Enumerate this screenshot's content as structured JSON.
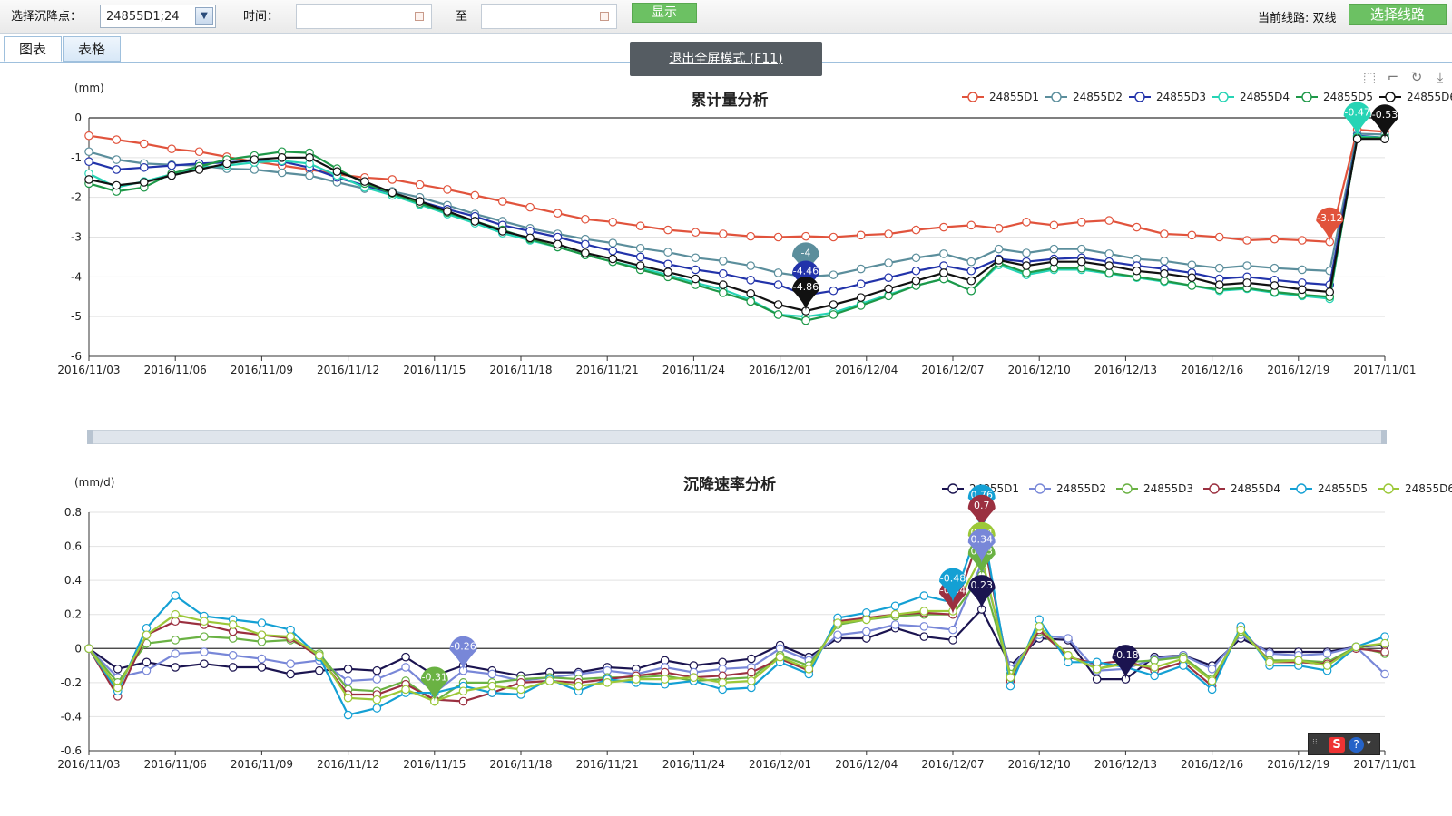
{
  "toolbar": {
    "point_label": "选择沉降点：",
    "point_value": "24855D1;24",
    "time_label": "时间：",
    "to_label": "至",
    "time_start": "",
    "time_end": "",
    "show_button": "显示",
    "line_label": "当前线路: 双线",
    "select_line_button": "选择线路"
  },
  "tabs": [
    {
      "label": "图表",
      "active": true
    },
    {
      "label": "表格",
      "active": false
    }
  ],
  "fullscreen_banner": "退出全屏模式 (F11)",
  "tool_icons": [
    "zoom-select-icon",
    "zoom-reset-icon",
    "restore-icon",
    "download-icon"
  ],
  "chart_data": [
    {
      "type": "line",
      "title": "累计量分析",
      "ylabel": "(mm)",
      "ylim": [
        -6,
        0
      ],
      "yticks": [
        "0",
        "-1",
        "-2",
        "-3",
        "-4",
        "-5",
        "-6"
      ],
      "xticks": [
        "2016/11/03",
        "2016/11/06",
        "2016/11/09",
        "2016/11/12",
        "2016/11/15",
        "2016/11/18",
        "2016/11/21",
        "2016/11/24",
        "2016/12/01",
        "2016/12/04",
        "2016/12/07",
        "2016/12/10",
        "2016/12/13",
        "2016/12/16",
        "2016/12/19",
        "2017/11/01"
      ],
      "legend_position": "top-right",
      "series": [
        {
          "name": "24855D1",
          "color": "#e1533c",
          "values": [
            -0.45,
            -0.55,
            -0.65,
            -0.78,
            -0.85,
            -0.98,
            -1.1,
            -1.2,
            -1.3,
            -1.42,
            -1.5,
            -1.55,
            -1.68,
            -1.8,
            -1.95,
            -2.1,
            -2.25,
            -2.4,
            -2.55,
            -2.62,
            -2.72,
            -2.82,
            -2.88,
            -2.92,
            -2.98,
            -3.0,
            -2.98,
            -3.0,
            -2.95,
            -2.92,
            -2.82,
            -2.75,
            -2.7,
            -2.78,
            -2.62,
            -2.7,
            -2.62,
            -2.58,
            -2.75,
            -2.92,
            -2.95,
            -3.0,
            -3.08,
            -3.05,
            -3.08,
            -3.12,
            -0.3,
            -0.35
          ]
        },
        {
          "name": "24855D2",
          "color": "#5b8e9c",
          "values": [
            -0.85,
            -1.05,
            -1.15,
            -1.18,
            -1.2,
            -1.28,
            -1.3,
            -1.38,
            -1.45,
            -1.62,
            -1.78,
            -1.85,
            -2.0,
            -2.2,
            -2.42,
            -2.6,
            -2.78,
            -2.92,
            -3.05,
            -3.15,
            -3.28,
            -3.38,
            -3.52,
            -3.6,
            -3.72,
            -3.9,
            -4.0,
            -3.95,
            -3.8,
            -3.65,
            -3.52,
            -3.42,
            -3.62,
            -3.3,
            -3.4,
            -3.3,
            -3.3,
            -3.42,
            -3.55,
            -3.6,
            -3.7,
            -3.78,
            -3.72,
            -3.78,
            -3.82,
            -3.85,
            -0.4,
            -0.42
          ]
        },
        {
          "name": "24855D3",
          "color": "#2233aa",
          "values": [
            -1.1,
            -1.3,
            -1.25,
            -1.2,
            -1.15,
            -1.12,
            -1.08,
            -1.1,
            -1.25,
            -1.5,
            -1.7,
            -1.9,
            -2.1,
            -2.3,
            -2.48,
            -2.7,
            -2.85,
            -3.0,
            -3.18,
            -3.35,
            -3.5,
            -3.68,
            -3.82,
            -3.92,
            -4.08,
            -4.2,
            -4.46,
            -4.35,
            -4.18,
            -4.02,
            -3.85,
            -3.72,
            -3.85,
            -3.55,
            -3.62,
            -3.55,
            -3.52,
            -3.62,
            -3.72,
            -3.8,
            -3.9,
            -4.05,
            -4.0,
            -4.08,
            -4.15,
            -4.2,
            -0.45,
            -0.5
          ]
        },
        {
          "name": "24855D4",
          "color": "#26d4b5",
          "values": [
            -1.4,
            -1.75,
            -1.6,
            -1.42,
            -1.25,
            -1.2,
            -1.12,
            -1.08,
            -1.15,
            -1.45,
            -1.75,
            -1.95,
            -2.18,
            -2.42,
            -2.65,
            -2.9,
            -3.08,
            -3.25,
            -3.45,
            -3.62,
            -3.78,
            -3.95,
            -4.15,
            -4.32,
            -4.58,
            -4.95,
            -5.0,
            -4.9,
            -4.68,
            -4.45,
            -4.22,
            -4.05,
            -4.35,
            -3.7,
            -3.95,
            -3.82,
            -3.82,
            -3.92,
            -4.02,
            -4.12,
            -4.22,
            -4.35,
            -4.3,
            -4.4,
            -4.48,
            -4.55,
            -0.47,
            -0.5
          ]
        },
        {
          "name": "24855D5",
          "color": "#1e9848",
          "values": [
            -1.65,
            -1.85,
            -1.75,
            -1.4,
            -1.22,
            -1.05,
            -0.95,
            -0.85,
            -0.88,
            -1.28,
            -1.65,
            -1.9,
            -2.15,
            -2.38,
            -2.6,
            -2.82,
            -3.05,
            -3.25,
            -3.45,
            -3.62,
            -3.82,
            -4.0,
            -4.2,
            -4.4,
            -4.62,
            -4.95,
            -5.1,
            -4.95,
            -4.72,
            -4.48,
            -4.22,
            -4.05,
            -4.35,
            -3.65,
            -3.9,
            -3.78,
            -3.78,
            -3.9,
            -4.0,
            -4.1,
            -4.22,
            -4.32,
            -4.28,
            -4.38,
            -4.45,
            -4.5,
            -0.5,
            -0.5
          ]
        },
        {
          "name": "24855D6",
          "color": "#111111",
          "values": [
            -1.55,
            -1.7,
            -1.62,
            -1.45,
            -1.3,
            -1.15,
            -1.05,
            -1.0,
            -1.0,
            -1.35,
            -1.6,
            -1.88,
            -2.1,
            -2.35,
            -2.6,
            -2.85,
            -3.02,
            -3.18,
            -3.4,
            -3.55,
            -3.72,
            -3.88,
            -4.05,
            -4.2,
            -4.42,
            -4.7,
            -4.86,
            -4.7,
            -4.52,
            -4.3,
            -4.1,
            -3.9,
            -4.1,
            -3.58,
            -3.72,
            -3.62,
            -3.62,
            -3.72,
            -3.85,
            -3.92,
            -4.02,
            -4.2,
            -4.15,
            -4.22,
            -4.32,
            -4.38,
            -0.53,
            -0.53
          ]
        }
      ],
      "annotations": [
        {
          "series": 0,
          "index": 45,
          "label": "-3.12"
        },
        {
          "series": 1,
          "index": 26,
          "label": "-4"
        },
        {
          "series": 2,
          "index": 26,
          "label": "-4.46"
        },
        {
          "series": 5,
          "index": 26,
          "label": "-4.86"
        },
        {
          "series": 3,
          "index": 46,
          "label": "-0.47"
        },
        {
          "series": 5,
          "index": 47,
          "label": "-0.53"
        }
      ]
    },
    {
      "type": "line",
      "title": "沉降速率分析",
      "ylabel": "(mm/d)",
      "ylim": [
        -0.6,
        0.8
      ],
      "yticks": [
        "0.8",
        "0.6",
        "0.4",
        "0.2",
        "0",
        "-0.2",
        "-0.4",
        "-0.6"
      ],
      "xticks": [
        "2016/11/03",
        "2016/11/06",
        "2016/11/09",
        "2016/11/12",
        "2016/11/15",
        "2016/11/18",
        "2016/11/21",
        "2016/11/24",
        "2016/12/01",
        "2016/12/04",
        "2016/12/07",
        "2016/12/10",
        "2016/12/13",
        "2016/12/16",
        "2016/12/19",
        "2017/11/01"
      ],
      "legend_position": "top-right",
      "series": [
        {
          "name": "24855D1",
          "color": "#1b1450",
          "values": [
            0,
            -0.12,
            -0.08,
            -0.11,
            -0.09,
            -0.11,
            -0.11,
            -0.15,
            -0.13,
            -0.12,
            -0.13,
            -0.05,
            -0.16,
            -0.1,
            -0.13,
            -0.16,
            -0.14,
            -0.14,
            -0.11,
            -0.12,
            -0.07,
            -0.1,
            -0.08,
            -0.06,
            0.02,
            -0.05,
            0.06,
            0.06,
            0.12,
            0.07,
            0.05,
            0.23,
            -0.1,
            0.06,
            0.05,
            -0.18,
            -0.18,
            -0.05,
            -0.04,
            -0.1,
            0.06,
            -0.02,
            -0.02,
            -0.02,
            0.01,
            0.02
          ]
        },
        {
          "name": "24855D2",
          "color": "#7887d8",
          "values": [
            0,
            -0.17,
            -0.13,
            -0.03,
            -0.02,
            -0.04,
            -0.06,
            -0.09,
            -0.07,
            -0.19,
            -0.18,
            -0.11,
            -0.26,
            -0.13,
            -0.15,
            -0.19,
            -0.17,
            -0.15,
            -0.13,
            -0.15,
            -0.11,
            -0.14,
            -0.12,
            -0.11,
            0.0,
            -0.07,
            0.08,
            0.1,
            0.14,
            0.13,
            0.11,
            0.5,
            -0.12,
            0.08,
            0.06,
            -0.13,
            -0.12,
            -0.06,
            -0.04,
            -0.12,
            0.08,
            -0.03,
            -0.04,
            -0.03,
            0.01,
            -0.15
          ]
        },
        {
          "name": "24855D3",
          "color": "#6ab243",
          "values": [
            0,
            -0.2,
            0.03,
            0.05,
            0.07,
            0.06,
            0.04,
            0.05,
            -0.03,
            -0.24,
            -0.25,
            -0.19,
            -0.31,
            -0.2,
            -0.2,
            -0.18,
            -0.17,
            -0.18,
            -0.17,
            -0.17,
            -0.16,
            -0.19,
            -0.18,
            -0.17,
            -0.04,
            -0.1,
            0.14,
            0.17,
            0.19,
            0.2,
            0.2,
            0.43,
            -0.15,
            0.1,
            -0.04,
            -0.12,
            -0.08,
            -0.07,
            -0.05,
            -0.18,
            0.1,
            -0.07,
            -0.07,
            -0.08,
            0.01,
            -0.03
          ]
        },
        {
          "name": "24855D4",
          "color": "#9b3040",
          "values": [
            0,
            -0.28,
            0.08,
            0.16,
            0.14,
            0.1,
            0.08,
            0.06,
            -0.05,
            -0.27,
            -0.27,
            -0.21,
            -0.3,
            -0.31,
            -0.26,
            -0.2,
            -0.19,
            -0.2,
            -0.18,
            -0.16,
            -0.14,
            -0.17,
            -0.16,
            -0.14,
            -0.06,
            -0.13,
            0.16,
            0.18,
            0.2,
            0.21,
            0.2,
            0.7,
            -0.19,
            0.11,
            -0.05,
            -0.09,
            -0.07,
            -0.13,
            -0.08,
            -0.22,
            0.12,
            -0.08,
            -0.08,
            -0.09,
            0.0,
            -0.02
          ]
        },
        {
          "name": "24855D5",
          "color": "#14a0d4",
          "values": [
            0,
            -0.25,
            0.12,
            0.31,
            0.19,
            0.17,
            0.15,
            0.11,
            -0.05,
            -0.39,
            -0.35,
            -0.26,
            -0.26,
            -0.22,
            -0.26,
            -0.27,
            -0.18,
            -0.25,
            -0.18,
            -0.2,
            -0.21,
            -0.19,
            -0.24,
            -0.23,
            -0.08,
            -0.15,
            0.18,
            0.21,
            0.25,
            0.31,
            0.27,
            0.76,
            -0.22,
            0.17,
            -0.08,
            -0.08,
            -0.11,
            -0.16,
            -0.1,
            -0.24,
            0.13,
            -0.1,
            -0.1,
            -0.13,
            0.01,
            0.07
          ]
        },
        {
          "name": "24855D6",
          "color": "#9cc838",
          "values": [
            0,
            -0.23,
            0.08,
            0.2,
            0.16,
            0.14,
            0.08,
            0.07,
            -0.04,
            -0.29,
            -0.3,
            -0.24,
            -0.31,
            -0.25,
            -0.22,
            -0.24,
            -0.19,
            -0.22,
            -0.2,
            -0.18,
            -0.18,
            -0.17,
            -0.2,
            -0.19,
            -0.05,
            -0.12,
            0.15,
            0.17,
            0.2,
            0.22,
            0.22,
            0.54,
            -0.17,
            0.13,
            -0.04,
            -0.12,
            -0.09,
            -0.11,
            -0.06,
            -0.19,
            0.11,
            -0.08,
            -0.07,
            -0.1,
            0.01,
            0.03
          ]
        }
      ],
      "annotations": [
        {
          "series": 2,
          "index": 12,
          "label": "-0.31"
        },
        {
          "series": 1,
          "index": 13,
          "label": "-0.26"
        },
        {
          "series": 3,
          "index": 30,
          "label": "-0.34"
        },
        {
          "series": 4,
          "index": 30,
          "label": "-0.48"
        },
        {
          "series": 4,
          "index": 31,
          "label": "0.76"
        },
        {
          "series": 3,
          "index": 31,
          "label": "0.7"
        },
        {
          "series": 5,
          "index": 31,
          "label": "0.54"
        },
        {
          "series": 2,
          "index": 31,
          "label": "0.43"
        },
        {
          "series": 1,
          "index": 31,
          "label": "0.34"
        },
        {
          "series": 0,
          "index": 31,
          "label": "0.23"
        },
        {
          "series": 0,
          "index": 36,
          "label": "-0.18"
        }
      ]
    }
  ]
}
